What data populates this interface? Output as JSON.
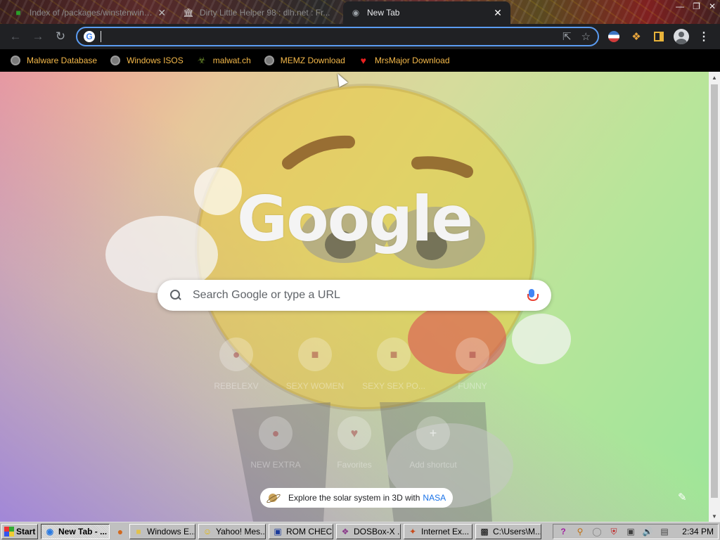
{
  "browser": {
    "tabs": [
      {
        "title": "Index of /packages/winstenwinxp...",
        "icon": "folder-green-icon",
        "active": false
      },
      {
        "title": "Dirty Little Helper 98 : dlh.net : Fr...",
        "icon": "museum-icon",
        "active": false
      },
      {
        "title": "New Tab",
        "icon": "chrome-icon",
        "active": true
      }
    ],
    "window_controls": [
      "minimize",
      "restore",
      "close"
    ],
    "toolbar": {
      "address_value": "",
      "nav": [
        "back",
        "forward",
        "reload"
      ],
      "right_icons": [
        "share-icon",
        "star-icon"
      ],
      "extensions": [
        "flag-extension-icon",
        "puzzle-extensions-icon",
        "side-panel-icon",
        "profile-icon",
        "menu-icon"
      ]
    },
    "bookmarks": [
      {
        "label": "Malware Database",
        "icon": "globe-icon"
      },
      {
        "label": "Windows ISOS",
        "icon": "globe-icon"
      },
      {
        "label": "malwat.ch",
        "icon": "biohazard-icon"
      },
      {
        "label": "MEMZ Download",
        "icon": "globe-icon"
      },
      {
        "label": "MrsMajor Download",
        "icon": "heart-icon"
      }
    ]
  },
  "ntp": {
    "logo_text": "Google",
    "search_placeholder": "Search Google or type a URL",
    "shortcuts": [
      {
        "label": "REBELEXV",
        "icon": "site-icon"
      },
      {
        "label": "SEXY WOMEN",
        "icon": "site-icon"
      },
      {
        "label": "SEXY SEX PO...",
        "icon": "site-icon"
      },
      {
        "label": "FUNNY",
        "icon": "site-icon"
      },
      {
        "label": "NEW EXTRA",
        "icon": "site-icon"
      },
      {
        "label": "Favorites",
        "icon": "heart-icon"
      },
      {
        "label": "Add shortcut",
        "icon": "plus-icon"
      }
    ],
    "attribution": {
      "text": "Explore the solar system in 3D with",
      "link": "NASA"
    }
  },
  "taskbar": {
    "start_label": "Start",
    "tasks": [
      {
        "label": "New Tab - ...",
        "icon": "chrome-icon",
        "active": true
      },
      {
        "label": "Windows E...",
        "icon": "folder-icon",
        "active": false
      },
      {
        "label": "Yahoo! Mes...",
        "icon": "smiley-icon",
        "active": false
      },
      {
        "label": "ROM CHEC...",
        "icon": "app-icon",
        "active": false
      },
      {
        "label": "DOSBox-X ...",
        "icon": "dosbox-icon",
        "active": false
      },
      {
        "label": "Internet Ex...",
        "icon": "ie-icon",
        "active": false
      },
      {
        "label": "C:\\Users\\M...",
        "icon": "cmd-icon",
        "active": false
      }
    ],
    "clock": "2:34 PM"
  }
}
